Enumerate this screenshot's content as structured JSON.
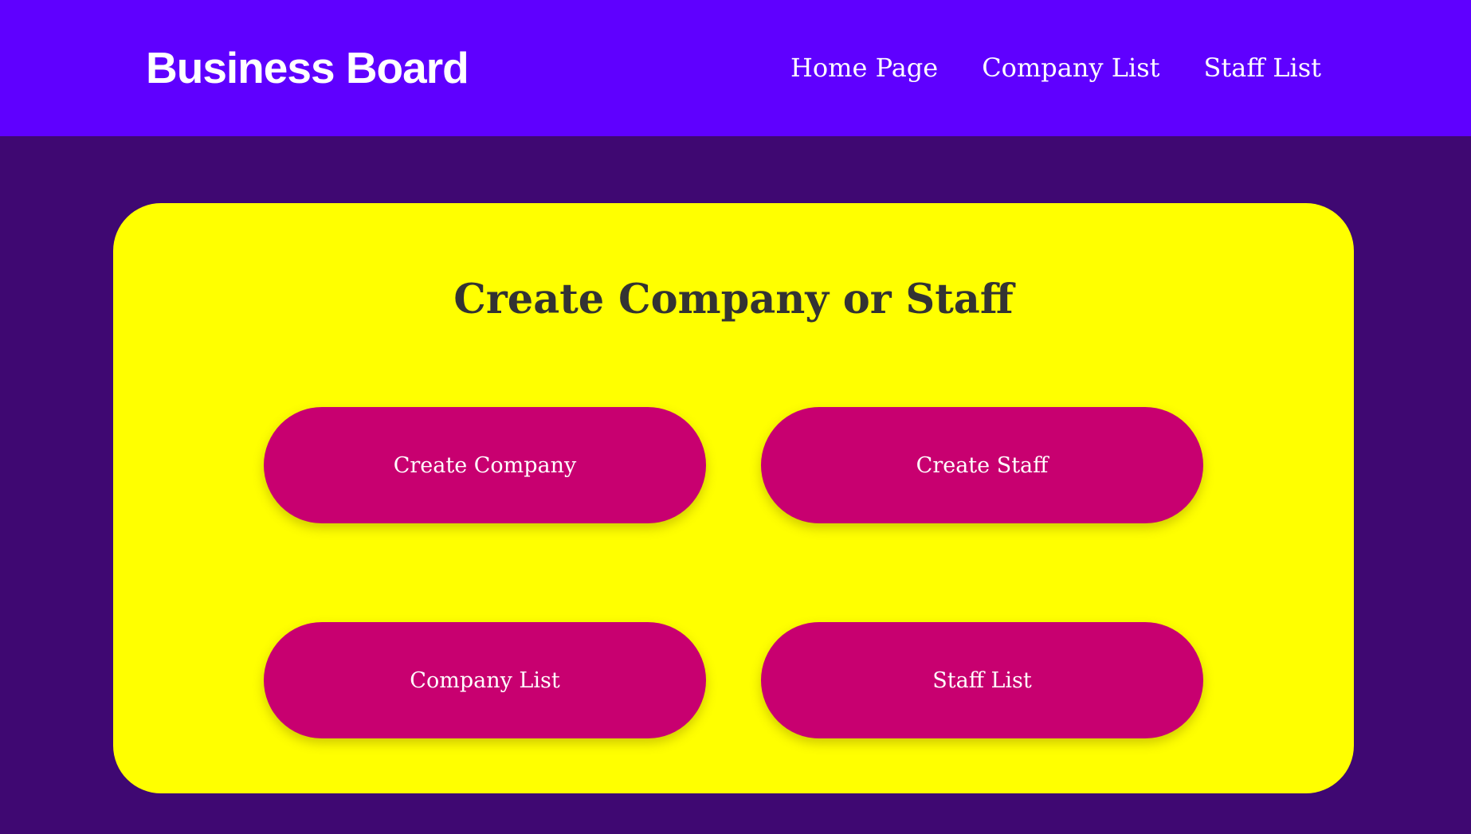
{
  "header": {
    "brand": "Business Board",
    "nav": [
      "Home Page",
      "Company List",
      "Staff List"
    ]
  },
  "main": {
    "title": "Create Company or Staff",
    "buttons": [
      "Create Company",
      "Create Staff",
      "Company List",
      "Staff List"
    ]
  },
  "colors": {
    "navbar": "#5f00ff",
    "background": "#3f0872",
    "card": "#ffff00",
    "button": "#c80070",
    "title_text": "#333333"
  }
}
